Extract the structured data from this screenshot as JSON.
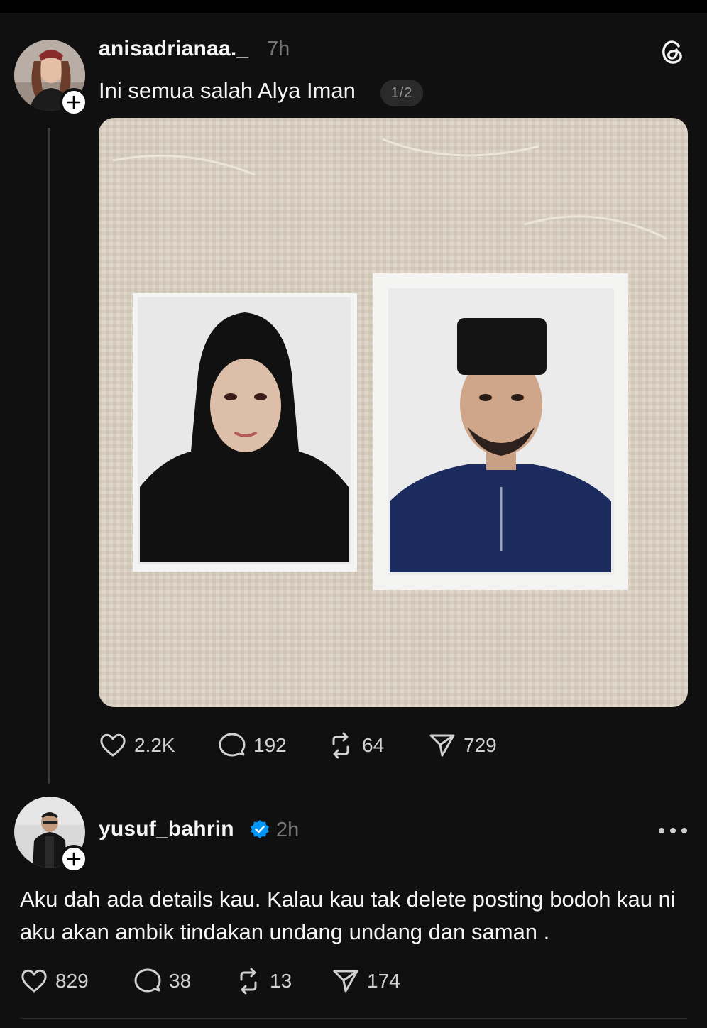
{
  "post": {
    "username": "anisadrianaa._",
    "time": "7h",
    "text": "Ini semua salah Alya Iman",
    "pager": "1/2",
    "stats": {
      "likes": "2.2K",
      "comments": "192",
      "reposts": "64",
      "shares": "729"
    }
  },
  "reply": {
    "username": "yusuf_bahrin",
    "time": "2h",
    "text": "Aku dah ada details kau. Kalau kau tak delete posting bodoh kau ni aku akan ambik tindakan undang undang dan saman .",
    "stats": {
      "likes": "829",
      "comments": "38",
      "reposts": "13",
      "shares": "174"
    }
  },
  "colors": {
    "background": "#101010",
    "verified": "#0095f6",
    "muted": "#777777"
  }
}
